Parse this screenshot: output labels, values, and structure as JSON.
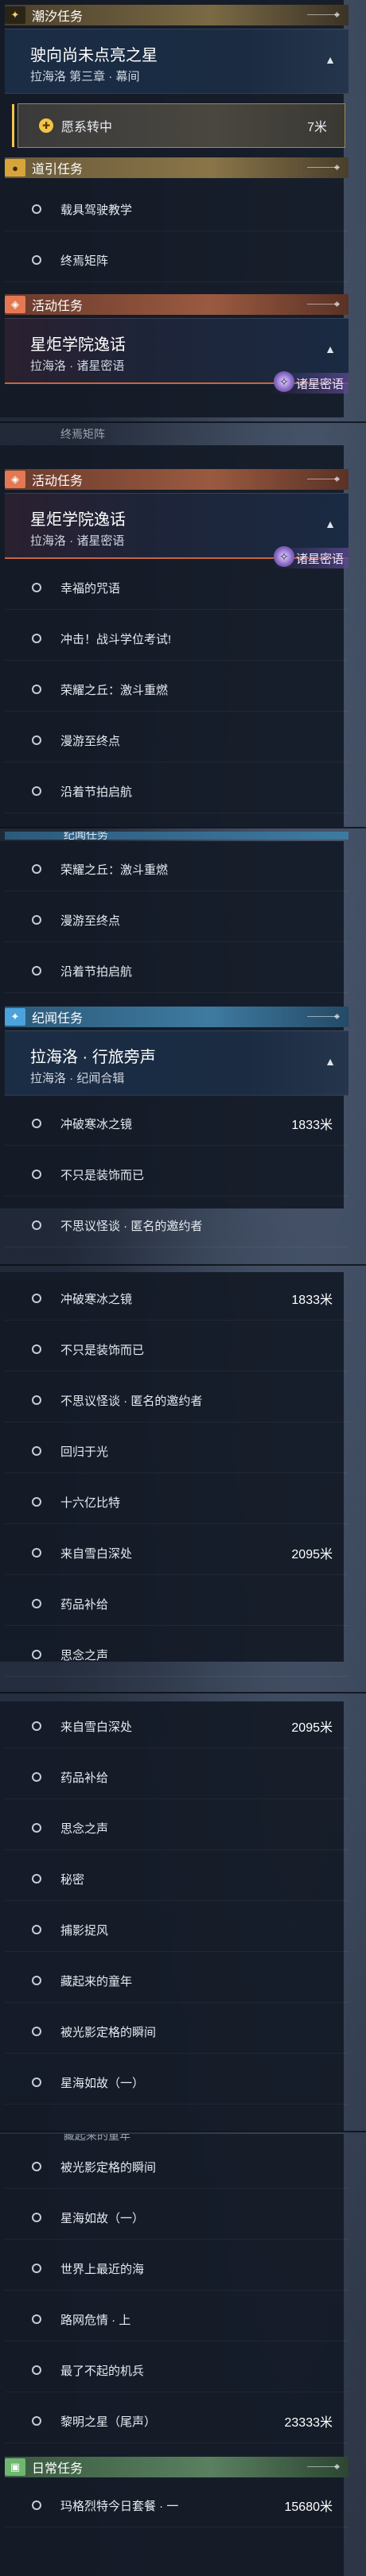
{
  "headers": {
    "tide": "潮汐任务",
    "guide": "道引任务",
    "event": "活动任务",
    "wander": "纪闻任务",
    "daily": "日常任务"
  },
  "tide_card": {
    "title": "驶向尚未点亮之星",
    "subtitle": "拉海洛 第三章 · 幕间"
  },
  "tracked": {
    "label": "愿系转中",
    "distance": "7米"
  },
  "guide_items": [
    "载具驾驶教学",
    "终焉矩阵"
  ],
  "event_card": {
    "title": "星炬学院逸话",
    "subtitle": "拉海洛 · 诸星密语",
    "badge": "诸星密语"
  },
  "event_items": [
    "幸福的咒语",
    "冲击！战斗学位考试!",
    "荣耀之丘：激斗重燃",
    "漫游至终点",
    "沿着节拍启航"
  ],
  "event_items_cont": [
    "荣耀之丘：激斗重燃",
    "漫游至终点",
    "沿着节拍启航"
  ],
  "wander_card": {
    "title": "拉海洛 · 行旅旁声",
    "subtitle": "拉海洛 · 纪闻合辑"
  },
  "wander_items_1": [
    {
      "label": "冲破寒冰之镜",
      "dist": "1833米"
    },
    {
      "label": "不只是装饰而已",
      "dist": ""
    },
    {
      "label": "不思议怪谈 · 匿名的邀约者",
      "dist": ""
    }
  ],
  "wander_items_2": [
    {
      "label": "冲破寒冰之镜",
      "dist": "1833米"
    },
    {
      "label": "不只是装饰而已",
      "dist": ""
    },
    {
      "label": "不思议怪谈 · 匿名的邀约者",
      "dist": ""
    },
    {
      "label": "回归于光",
      "dist": ""
    },
    {
      "label": "十六亿比特",
      "dist": ""
    },
    {
      "label": "来自雪白深处",
      "dist": "2095米"
    },
    {
      "label": "药品补给",
      "dist": ""
    },
    {
      "label": "思念之声",
      "dist": ""
    }
  ],
  "wander_items_3": [
    {
      "label": "来自雪白深处",
      "dist": "2095米"
    },
    {
      "label": "药品补给",
      "dist": ""
    },
    {
      "label": "思念之声",
      "dist": ""
    },
    {
      "label": "秘密",
      "dist": ""
    },
    {
      "label": "捕影捉风",
      "dist": ""
    },
    {
      "label": "藏起来的童年",
      "dist": ""
    },
    {
      "label": "被光影定格的瞬间",
      "dist": ""
    },
    {
      "label": "星海如故（一）",
      "dist": ""
    }
  ],
  "wander_items_4": [
    {
      "label": "被光影定格的瞬间",
      "dist": ""
    },
    {
      "label": "星海如故（一）",
      "dist": ""
    },
    {
      "label": "世界上最近的海",
      "dist": ""
    },
    {
      "label": "路网危情 · 上",
      "dist": ""
    },
    {
      "label": "最了不起的机兵",
      "dist": ""
    },
    {
      "label": "黎明之星（尾声）",
      "dist": "23333米"
    }
  ],
  "daily_items": [
    {
      "label": "玛格烈特今日套餐 · 一",
      "dist": "15680米"
    }
  ],
  "cut_texts": {
    "guide_cut": "终焉矩阵",
    "wander_cut": "纪闻任务",
    "hidden_cut": "藏起来的童年"
  }
}
